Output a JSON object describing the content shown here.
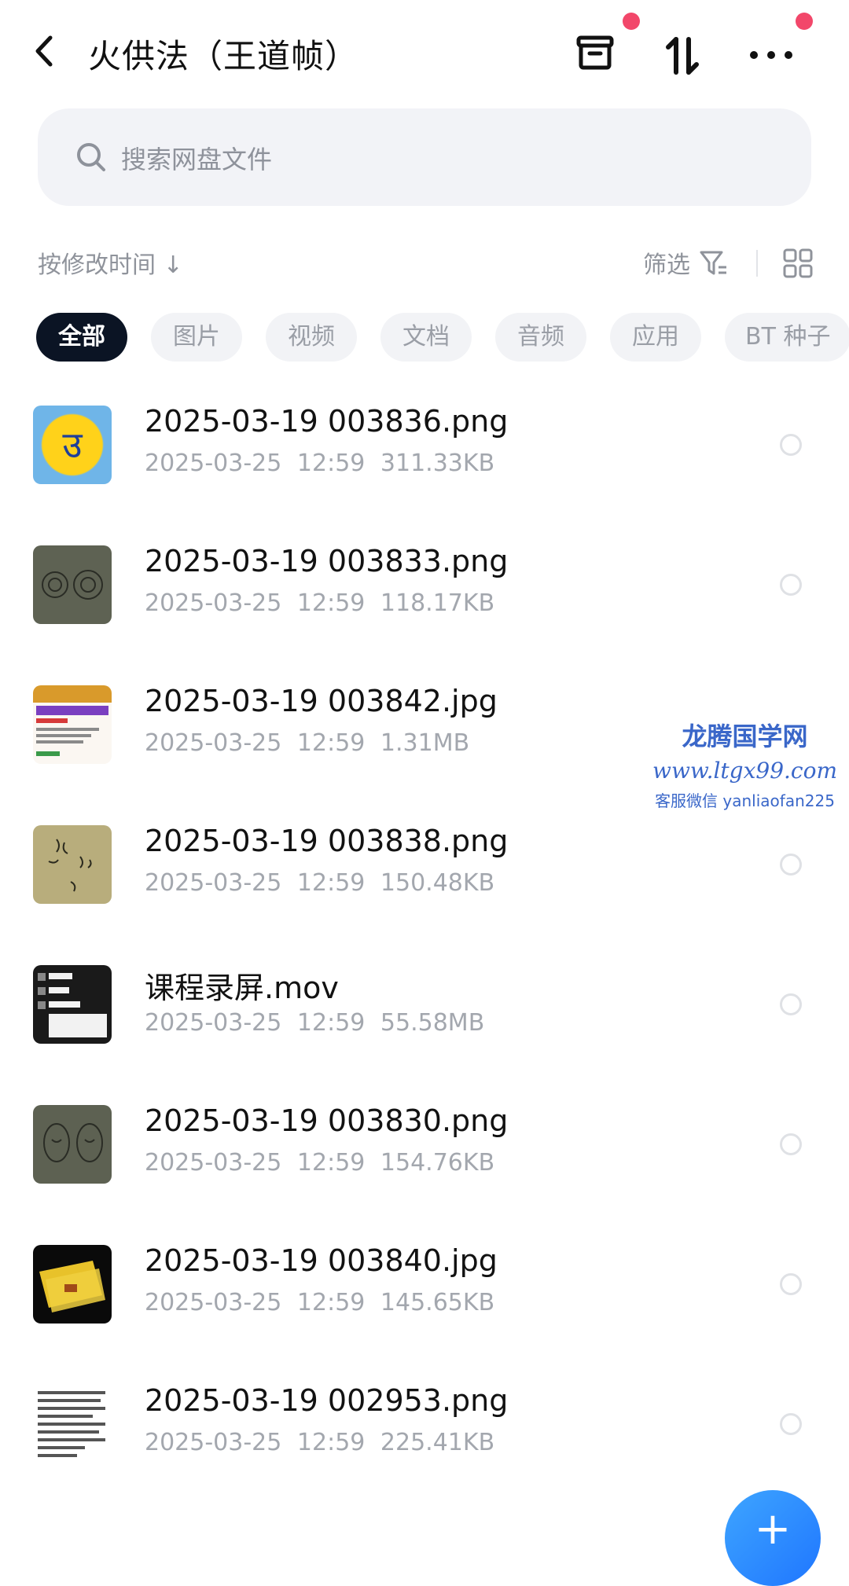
{
  "header": {
    "title": "火供法（王道帧）",
    "icons": [
      "back-icon",
      "archive-icon",
      "sort-toggle-icon",
      "more-icon"
    ],
    "badge_color": "#f2476a"
  },
  "search": {
    "placeholder": "搜索网盘文件"
  },
  "sort": {
    "label": "按修改时间 ↓",
    "filter_label": "筛选"
  },
  "tabs": [
    {
      "label": "全部",
      "active": true
    },
    {
      "label": "图片"
    },
    {
      "label": "视频"
    },
    {
      "label": "文档"
    },
    {
      "label": "音频"
    },
    {
      "label": "应用"
    },
    {
      "label": "BT 种子"
    }
  ],
  "files": [
    {
      "name": "2025-03-19 003836.png",
      "date": "2025-03-25",
      "time": "12:59",
      "size": "311.33KB"
    },
    {
      "name": "2025-03-19 003833.png",
      "date": "2025-03-25",
      "time": "12:59",
      "size": "118.17KB"
    },
    {
      "name": "2025-03-19 003842.jpg",
      "date": "2025-03-25",
      "time": "12:59",
      "size": "1.31MB"
    },
    {
      "name": "2025-03-19 003838.png",
      "date": "2025-03-25",
      "time": "12:59",
      "size": "150.48KB"
    },
    {
      "name": "课程录屏.mov",
      "date": "2025-03-25",
      "time": "12:59",
      "size": "55.58MB"
    },
    {
      "name": "2025-03-19 003830.png",
      "date": "2025-03-25",
      "time": "12:59",
      "size": "154.76KB"
    },
    {
      "name": "2025-03-19 003840.jpg",
      "date": "2025-03-25",
      "time": "12:59",
      "size": "145.65KB"
    },
    {
      "name": "2025-03-19 002953.png",
      "date": "2025-03-25",
      "time": "12:59",
      "size": "225.41KB"
    }
  ],
  "watermark": {
    "line1": "龙腾国学网",
    "line2": "www.ltgx99.com",
    "line3": "客服微信 yanliaofan225"
  },
  "fab": {
    "label": "+"
  }
}
